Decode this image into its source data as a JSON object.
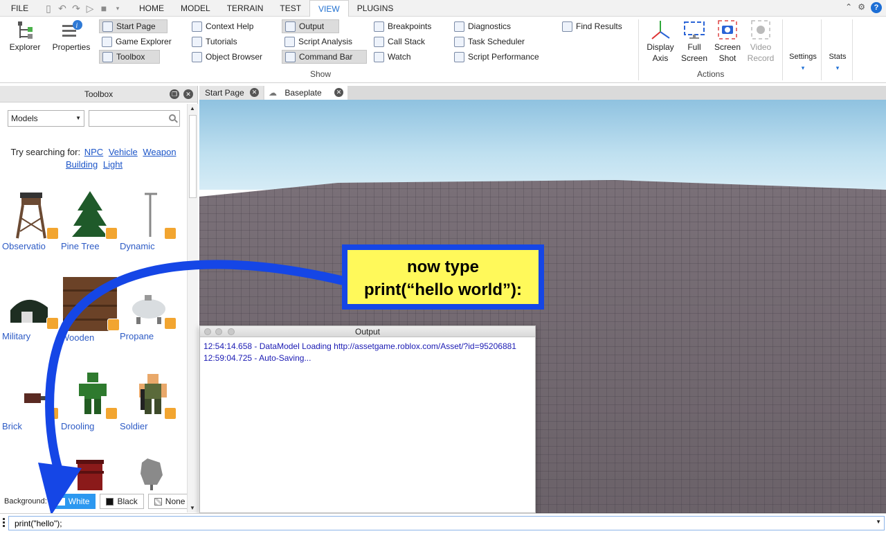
{
  "menubar": {
    "file": "FILE",
    "tabs": [
      "HOME",
      "MODEL",
      "TERRAIN",
      "TEST",
      "VIEW",
      "PLUGINS"
    ],
    "active_tab": "VIEW"
  },
  "ribbon": {
    "explorer": "Explorer",
    "properties": "Properties",
    "start_page": "Start Page",
    "game_explorer": "Game Explorer",
    "toolbox": "Toolbox",
    "context_help": "Context Help",
    "tutorials": "Tutorials",
    "object_browser": "Object Browser",
    "output": "Output",
    "script_analysis": "Script Analysis",
    "command_bar": "Command Bar",
    "breakpoints": "Breakpoints",
    "call_stack": "Call Stack",
    "watch": "Watch",
    "diagnostics": "Diagnostics",
    "task_scheduler": "Task Scheduler",
    "script_performance": "Script Performance",
    "find_results": "Find Results",
    "show_label": "Show",
    "display_axis_1": "Display",
    "display_axis_2": "Axis",
    "full_screen_1": "Full",
    "full_screen_2": "Screen",
    "screen_shot_1": "Screen",
    "screen_shot_2": "Shot",
    "video_record_1": "Video",
    "video_record_2": "Record",
    "actions_label": "Actions",
    "settings": "Settings",
    "stats": "Stats"
  },
  "toolbox": {
    "title": "Toolbox",
    "category": "Models",
    "search_placeholder": "",
    "try_label": "Try searching for:",
    "suggestions": [
      "NPC",
      "Vehicle",
      "Weapon",
      "Building",
      "Light"
    ],
    "assets": [
      "Observatio",
      "Pine Tree",
      "Dynamic",
      "Military",
      "Wooden",
      "Propane",
      "Brick",
      "Drooling",
      "Soldier"
    ],
    "background_label": "Background:",
    "bg_white": "White",
    "bg_black": "Black",
    "bg_none": "None"
  },
  "doc_tabs": {
    "start_page": "Start Page",
    "baseplate": "Baseplate"
  },
  "callout": {
    "line1": "now type",
    "line2": "print(“hello world”):"
  },
  "output": {
    "title": "Output",
    "lines": [
      "12:54:14.658 - DataModel Loading http://assetgame.roblox.com/Asset/?id=95206881",
      "12:59:04.725 - Auto-Saving..."
    ]
  },
  "command_bar": {
    "value": "print(\"hello\");"
  },
  "colors": {
    "accent": "#1c6ed5",
    "callout_border": "#1546e6",
    "callout_fill": "#fff95a",
    "output_text": "#1a1ab3"
  }
}
